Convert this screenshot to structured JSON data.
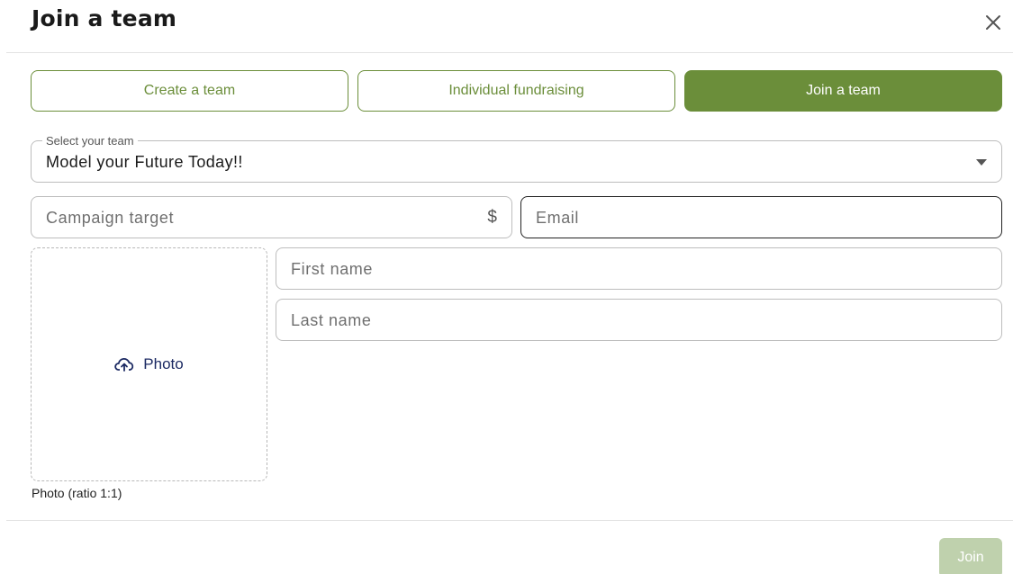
{
  "dialog": {
    "title": "Join a team",
    "close_icon": "close-icon"
  },
  "tabs": [
    {
      "label": "Create a team",
      "active": false
    },
    {
      "label": "Individual fundraising",
      "active": false
    },
    {
      "label": "Join a team",
      "active": true
    }
  ],
  "form": {
    "team_select": {
      "label": "Select your team",
      "value": "Model your Future Today!!",
      "icon": "dropdown-arrow-icon"
    },
    "campaign_target": {
      "placeholder": "Campaign target",
      "adornment": "$"
    },
    "email": {
      "placeholder": "Email"
    },
    "first_name": {
      "placeholder": "First name"
    },
    "last_name": {
      "placeholder": "Last name"
    },
    "photo": {
      "label": "Photo",
      "icon": "cloud-upload-icon",
      "caption": "Photo (ratio 1:1)"
    }
  },
  "footer": {
    "join_label": "Join"
  },
  "colors": {
    "primary": "#6b8e3a",
    "primary_disabled": "#bfd1ad",
    "photo_text": "#1c2a63"
  }
}
